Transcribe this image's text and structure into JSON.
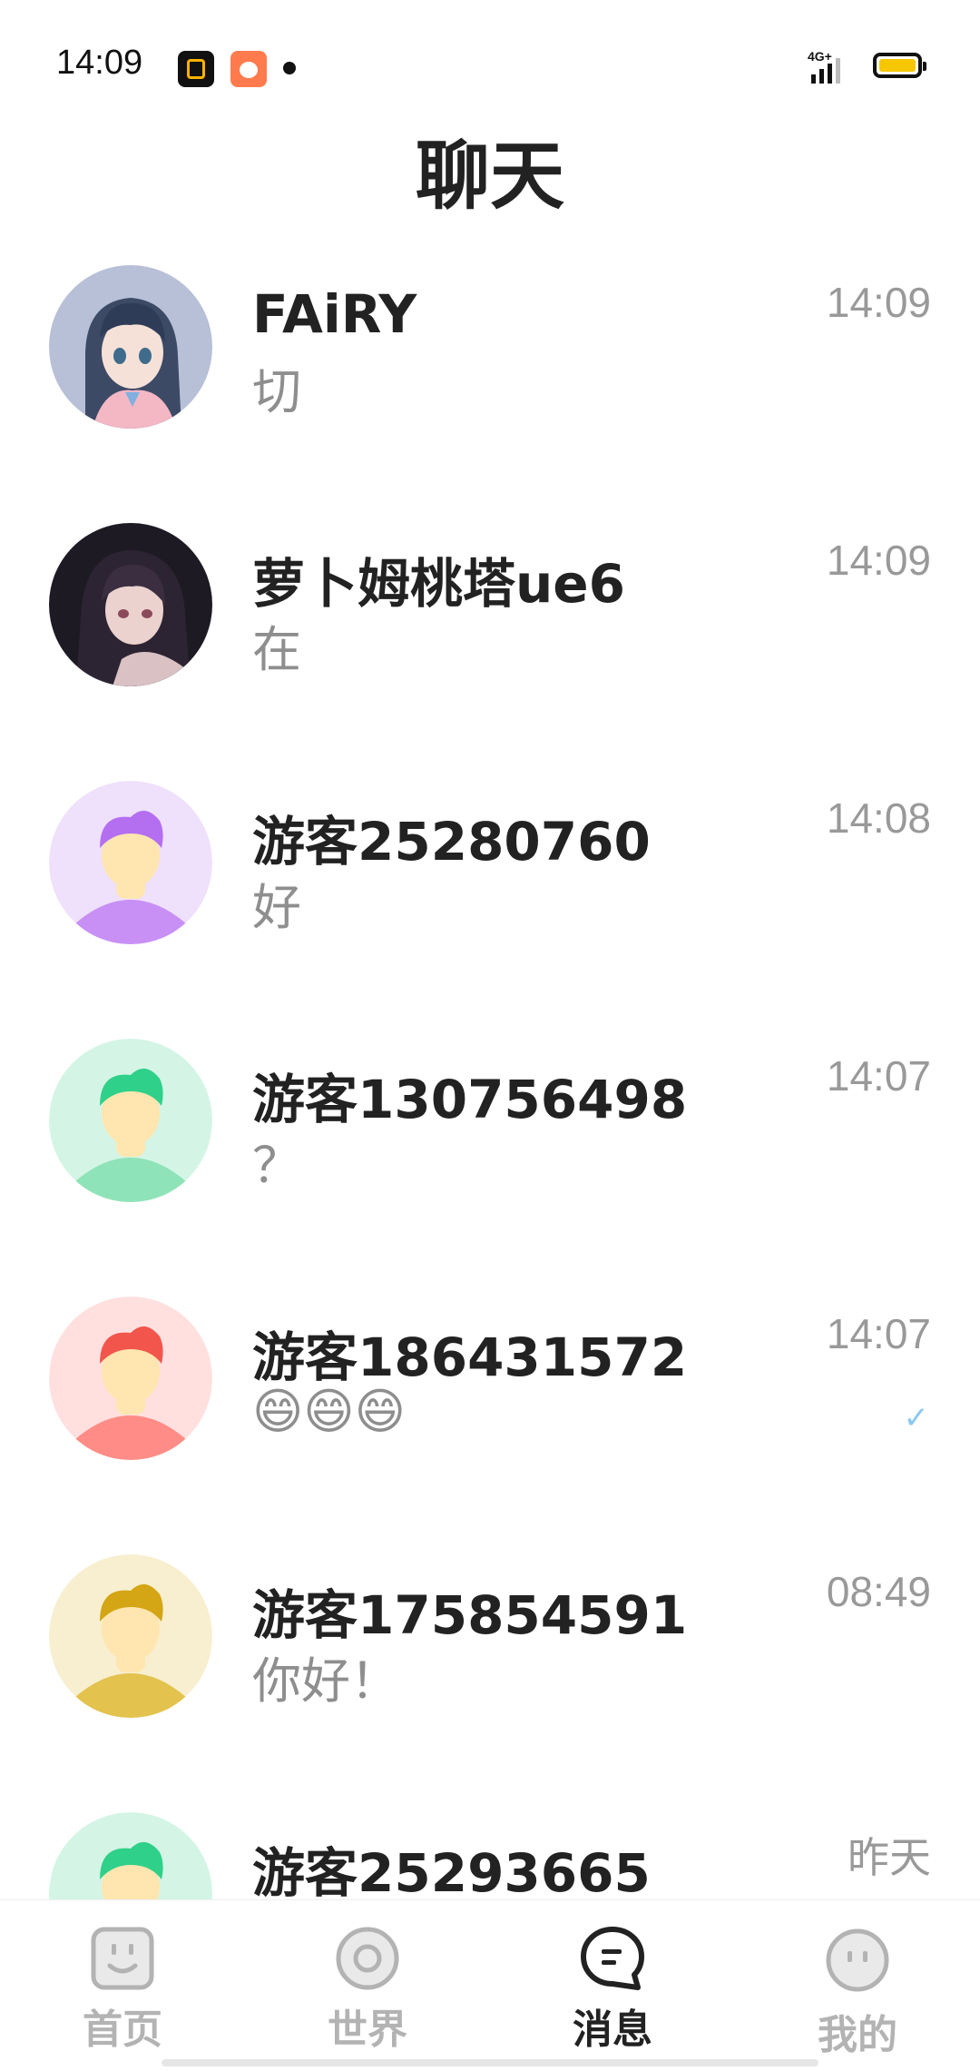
{
  "status_bar": {
    "time": "14:09",
    "network": "4G+",
    "app_icons": [
      "qq-browser-icon",
      "bunny-app-icon"
    ]
  },
  "header": {
    "title": "聊天"
  },
  "chats": [
    {
      "name": "FAiRY",
      "message": "切",
      "time": "14:09",
      "avatar": "anime-girl-blue-hair",
      "read": false
    },
    {
      "name": "萝卜姆桃塔ue6",
      "message": "在",
      "time": "14:09",
      "avatar": "anime-girl-dark",
      "read": false
    },
    {
      "name": "游客25280760",
      "message": "好",
      "time": "14:08",
      "avatar": "guest-purple",
      "read": false
    },
    {
      "name": "游客130756498",
      "message": "？",
      "time": "14:07",
      "avatar": "guest-green",
      "read": false
    },
    {
      "name": "游客186431572",
      "message": "😄😄😄",
      "time": "14:07",
      "avatar": "guest-red",
      "read": true
    },
    {
      "name": "游客175854591",
      "message": "你好！",
      "time": "08:49",
      "avatar": "guest-yellow",
      "read": false
    },
    {
      "name": "游客25293665",
      "message": "",
      "time": "昨天",
      "avatar": "guest-green",
      "read": false
    }
  ],
  "avatar_colors": {
    "guest-purple": {
      "bg": "#efe0fb",
      "hair": "#b46ff0",
      "body": "#c890f5"
    },
    "guest-green": {
      "bg": "#d4f5e6",
      "hair": "#2fd08a",
      "body": "#8fe3b8"
    },
    "guest-red": {
      "bg": "#ffe0df",
      "hair": "#f2554c",
      "body": "#ff8c86"
    },
    "guest-yellow": {
      "bg": "#f7efcf",
      "hair": "#d4a514",
      "body": "#e3c24e"
    }
  },
  "bottom_nav": {
    "items": [
      {
        "label": "首页",
        "icon": "home-face-icon",
        "active": false
      },
      {
        "label": "世界",
        "icon": "world-ring-icon",
        "active": false
      },
      {
        "label": "消息",
        "icon": "message-bubble-icon",
        "active": true
      },
      {
        "label": "我的",
        "icon": "profile-smile-icon",
        "active": false
      }
    ]
  }
}
